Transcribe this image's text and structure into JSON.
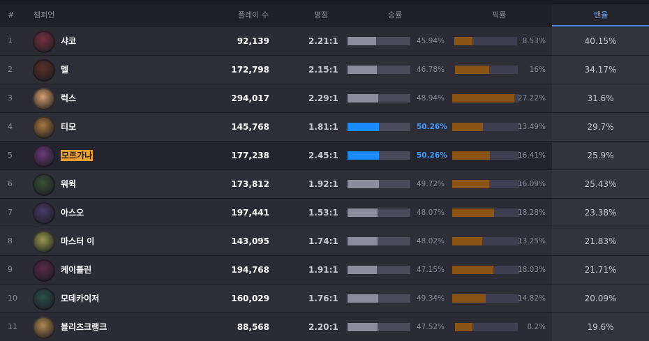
{
  "header": {
    "rank": "#",
    "champion": "챔피언",
    "plays": "플레이 수",
    "kda": "평점",
    "winrate": "승률",
    "pickrate": "픽률",
    "banrate": "밴율"
  },
  "colors": {
    "accent_blue": "#1a8cff",
    "pick_bar": "#8a5514",
    "highlight": "#f0a030",
    "active_tab": "#4c8dff"
  },
  "rows": [
    {
      "rank": "1",
      "name": "샤코",
      "plays": "92,139",
      "kda": "2.21:1",
      "win": "45.94%",
      "win_frac": 0.4594,
      "win_hl": false,
      "pick": "8.53%",
      "pick_frac": 0.0853,
      "ban": "40.15%",
      "avatar": "#7a3040",
      "highlight": false
    },
    {
      "rank": "2",
      "name": "멜",
      "plays": "172,798",
      "kda": "2.15:1",
      "win": "46.78%",
      "win_frac": 0.4678,
      "win_hl": false,
      "pick": "16%",
      "pick_frac": 0.16,
      "ban": "34.17%",
      "avatar": "#5a3028",
      "highlight": false
    },
    {
      "rank": "3",
      "name": "럭스",
      "plays": "294,017",
      "kda": "2.29:1",
      "win": "48.94%",
      "win_frac": 0.4894,
      "win_hl": false,
      "pick": "27.22%",
      "pick_frac": 0.2722,
      "ban": "31.6%",
      "avatar": "#d8a070",
      "highlight": false
    },
    {
      "rank": "4",
      "name": "티모",
      "plays": "145,768",
      "kda": "1.81:1",
      "win": "50.26%",
      "win_frac": 0.5026,
      "win_hl": true,
      "pick": "13.49%",
      "pick_frac": 0.1349,
      "ban": "29.7%",
      "avatar": "#a87840",
      "highlight": false
    },
    {
      "rank": "5",
      "name": "모르가나",
      "plays": "177,238",
      "kda": "2.45:1",
      "win": "50.26%",
      "win_frac": 0.5026,
      "win_hl": true,
      "pick": "16.41%",
      "pick_frac": 0.1641,
      "ban": "25.9%",
      "avatar": "#6a3a78",
      "highlight": true
    },
    {
      "rank": "6",
      "name": "워윅",
      "plays": "173,812",
      "kda": "1.92:1",
      "win": "49.72%",
      "win_frac": 0.4972,
      "win_hl": false,
      "pick": "16.09%",
      "pick_frac": 0.1609,
      "ban": "25.43%",
      "avatar": "#3a5038",
      "highlight": false
    },
    {
      "rank": "7",
      "name": "아스오",
      "plays": "197,441",
      "kda": "1.53:1",
      "win": "48.07%",
      "win_frac": 0.4807,
      "win_hl": false,
      "pick": "18.28%",
      "pick_frac": 0.1828,
      "ban": "23.38%",
      "avatar": "#4a3a68",
      "highlight": false
    },
    {
      "rank": "8",
      "name": "마스터 이",
      "plays": "143,095",
      "kda": "1.74:1",
      "win": "48.02%",
      "win_frac": 0.4802,
      "win_hl": false,
      "pick": "13.25%",
      "pick_frac": 0.1325,
      "ban": "21.83%",
      "avatar": "#9a9a50",
      "highlight": false
    },
    {
      "rank": "9",
      "name": "케이틀린",
      "plays": "194,768",
      "kda": "1.91:1",
      "win": "47.15%",
      "win_frac": 0.4715,
      "win_hl": false,
      "pick": "18.03%",
      "pick_frac": 0.1803,
      "ban": "21.71%",
      "avatar": "#5a2a48",
      "highlight": false
    },
    {
      "rank": "10",
      "name": "모데카이저",
      "plays": "160,029",
      "kda": "1.76:1",
      "win": "49.34%",
      "win_frac": 0.4934,
      "win_hl": false,
      "pick": "14.82%",
      "pick_frac": 0.1482,
      "ban": "20.09%",
      "avatar": "#2a5048",
      "highlight": false
    },
    {
      "rank": "11",
      "name": "블리츠크랭크",
      "plays": "88,568",
      "kda": "2.20:1",
      "win": "47.52%",
      "win_frac": 0.4752,
      "win_hl": false,
      "pick": "8.2%",
      "pick_frac": 0.082,
      "ban": "19.6%",
      "avatar": "#b08a50",
      "highlight": false
    }
  ]
}
